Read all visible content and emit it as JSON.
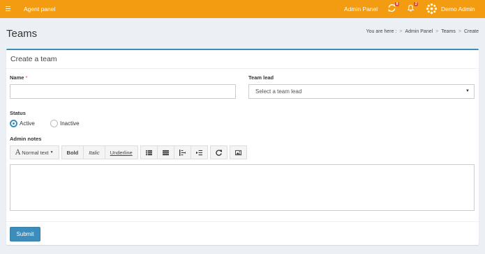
{
  "topbar": {
    "brand": "Agent panel",
    "admin_panel_link": "Admin Panel",
    "sync_badge": "8",
    "notifications_badge": "2",
    "user_name": "Demo Admin"
  },
  "page": {
    "title": "Teams",
    "breadcrumb": {
      "prefix": "You are here :",
      "items": [
        "Admin Panel",
        "Teams",
        "Create"
      ],
      "separator": ">"
    }
  },
  "form": {
    "box_title": "Create a team",
    "name_label": "Name",
    "required_mark": "*",
    "name_value": "",
    "team_lead_label": "Team lead",
    "team_lead_placeholder": "Select a team lead",
    "status_label": "Status",
    "status_options": [
      "Active",
      "Inactive"
    ],
    "status_selected": "Active",
    "admin_notes_label": "Admin notes",
    "toolbar": {
      "heading_dropdown": "Normal text",
      "bold": "Bold",
      "italic": "Italic",
      "underline": "Underline"
    },
    "submit_label": "Submit"
  },
  "colors": {
    "topbar": "#f39c12",
    "primary": "#3c8dbc",
    "badge": "#dd4b39",
    "background": "#ecf0f5"
  }
}
